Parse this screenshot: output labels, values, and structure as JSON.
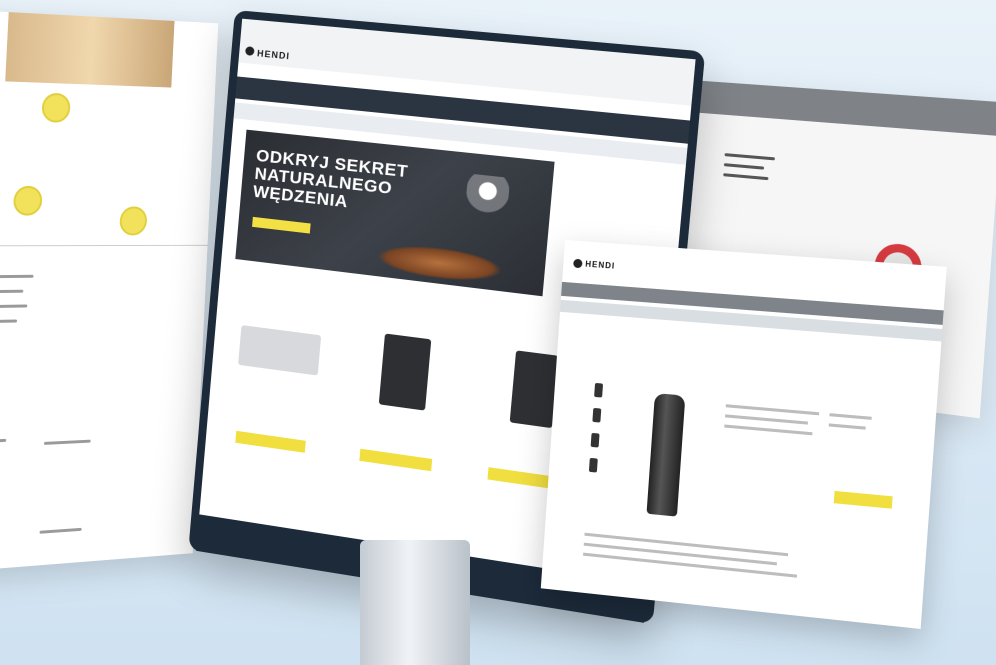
{
  "hero": {
    "title": "ODKRYJ SEKRET NATURALNEGO WĘDZENIA"
  },
  "brand": {
    "logo_text": "HENDI"
  },
  "colors": {
    "accent_yellow": "#f1df3f",
    "nav_dark": "#2b3542",
    "frame_dark": "#1c2a3a"
  }
}
